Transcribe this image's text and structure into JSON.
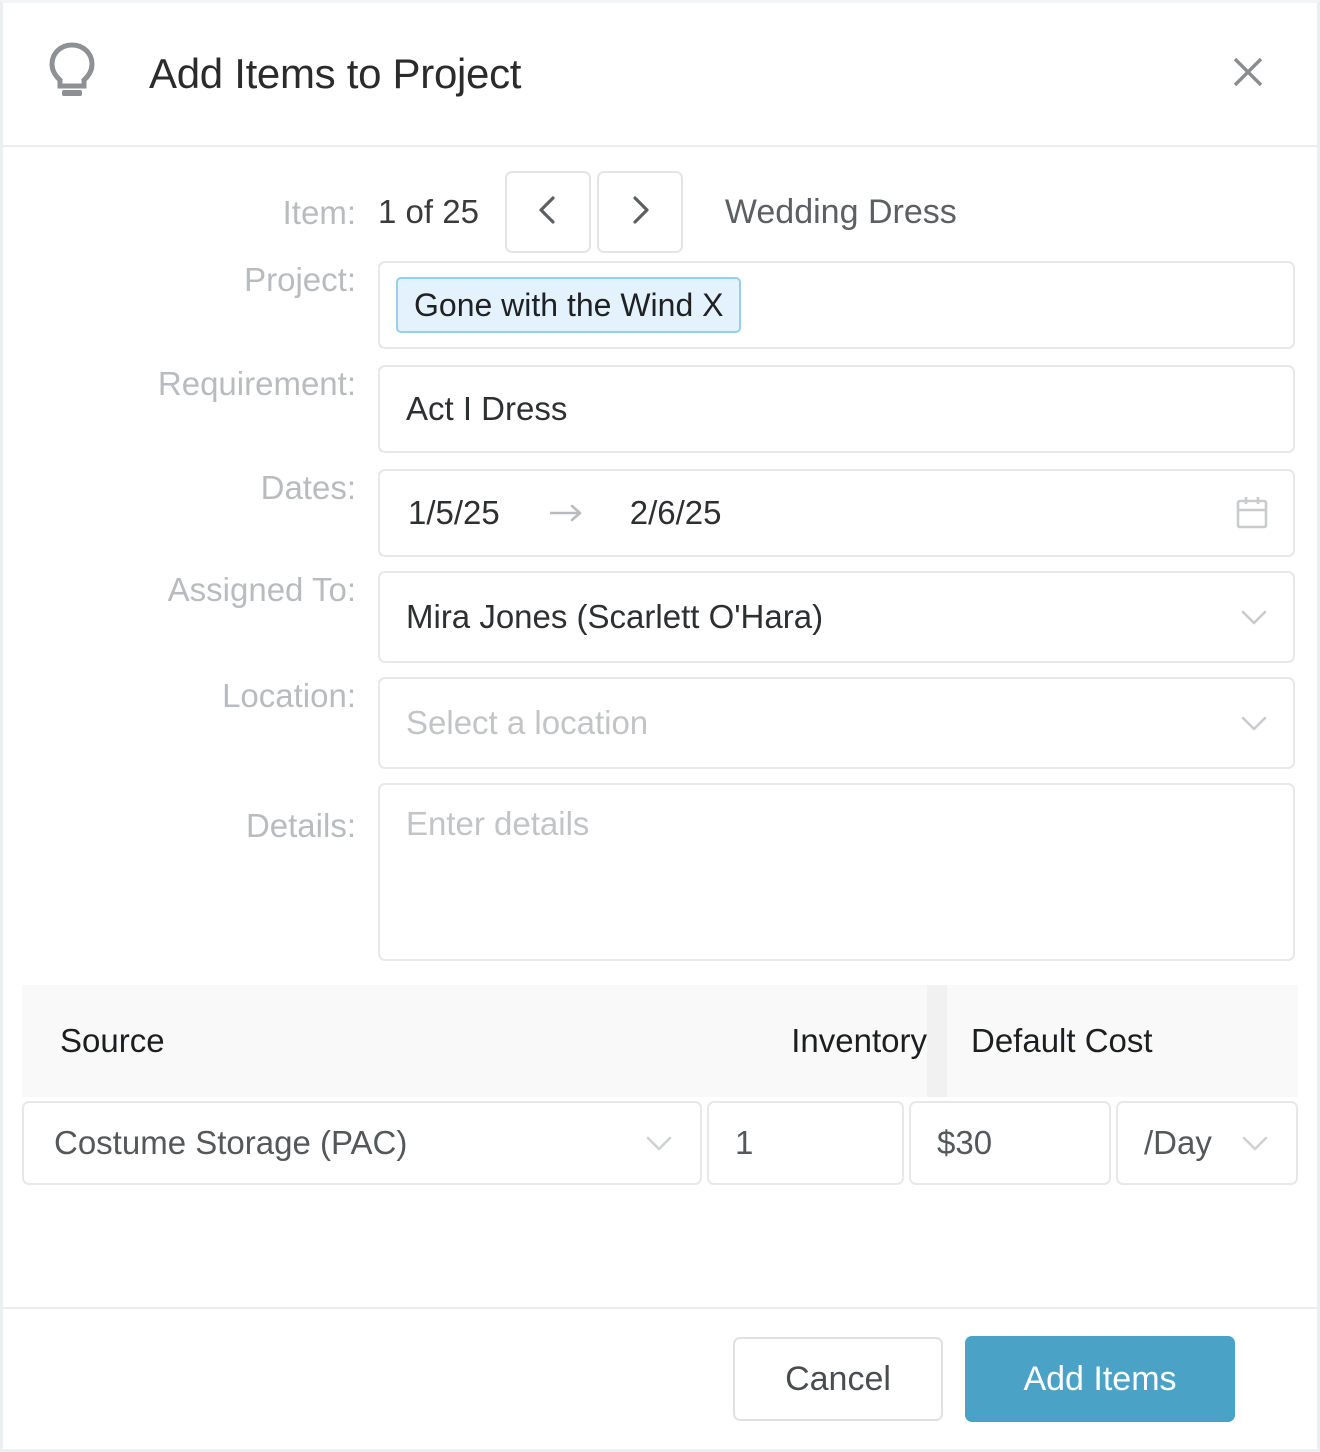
{
  "header": {
    "icon": "lightbulb-icon",
    "title": "Add Items to Project",
    "close_icon": "close-icon"
  },
  "form": {
    "item": {
      "label": "Item:",
      "count": "1 of 25",
      "prev_icon": "chevron-left-icon",
      "next_icon": "chevron-right-icon",
      "name": "Wedding Dress"
    },
    "project": {
      "label": "Project:",
      "tag": "Gone with the Wind X"
    },
    "requirement": {
      "label": "Requirement:",
      "value": "Act I Dress"
    },
    "dates": {
      "label": "Dates:",
      "start": "1/5/25",
      "arrow": "→",
      "end": "2/6/25",
      "calendar_icon": "calendar-icon"
    },
    "assigned_to": {
      "label": "Assigned To:",
      "value": "Mira Jones (Scarlett O'Hara)",
      "chevron_icon": "chevron-down-icon"
    },
    "location": {
      "label": "Location:",
      "placeholder": "Select a location",
      "chevron_icon": "chevron-down-icon"
    },
    "details": {
      "label": "Details:",
      "placeholder": "Enter details"
    }
  },
  "table": {
    "columns": [
      "Source",
      "Inventory",
      "Default Cost"
    ],
    "rows": [
      {
        "source": "Costume Storage (PAC)",
        "inventory": "1",
        "cost": "$30",
        "unit": "/Day"
      }
    ]
  },
  "footer": {
    "cancel_label": "Cancel",
    "submit_label": "Add Items"
  },
  "colors": {
    "accent": "#4aa3c7",
    "tag_background": "#e3f2fd",
    "tag_border": "#93d0f0",
    "label_text": "#b9bcbe",
    "table_header_background": "#f9f9f9"
  }
}
